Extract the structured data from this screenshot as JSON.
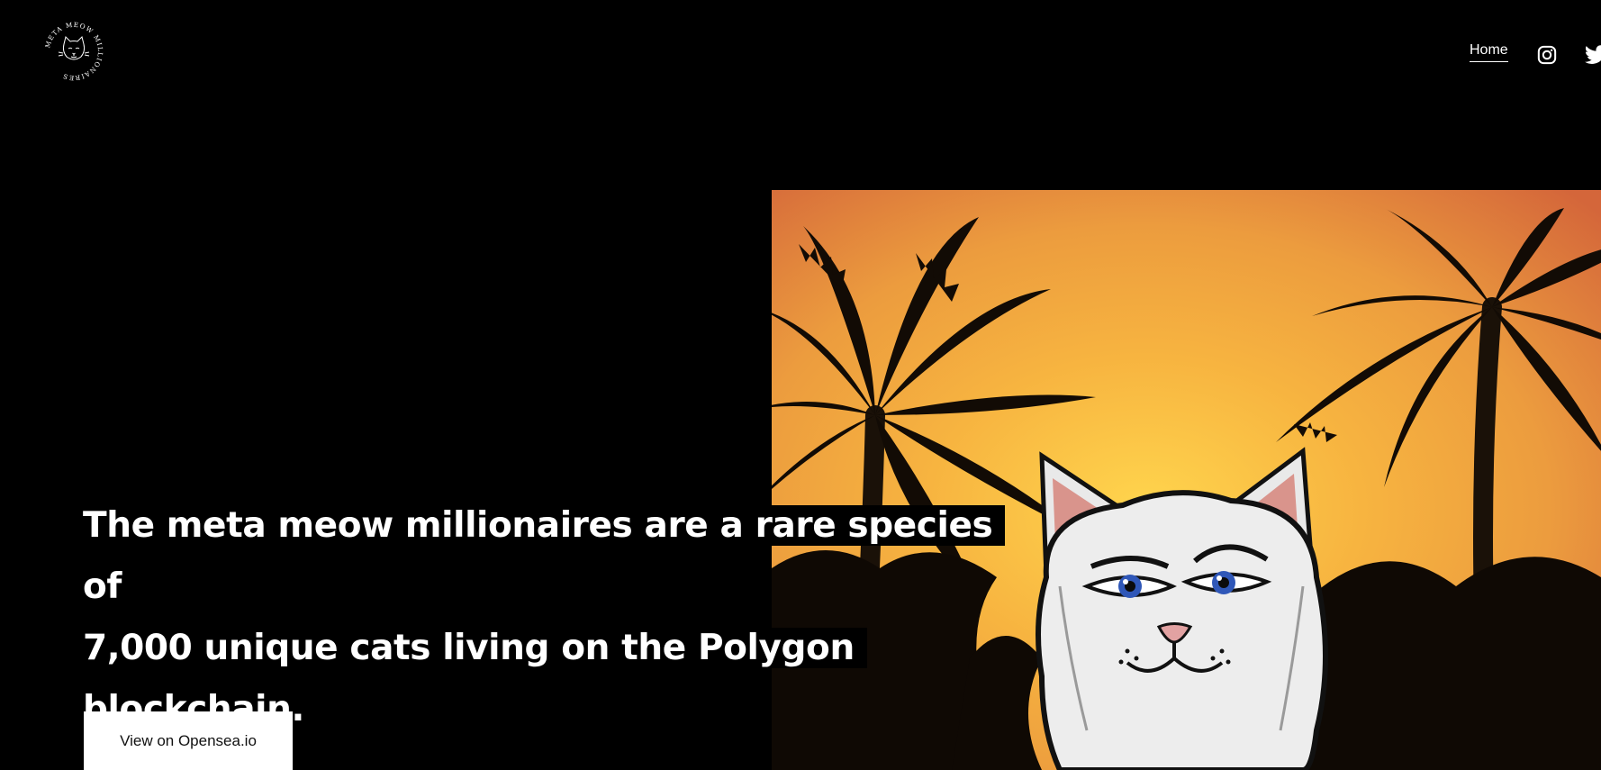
{
  "brand": {
    "logo_ring_text": "META MEOW MILLIONAIRES"
  },
  "nav": {
    "home_label": "Home",
    "instagram_icon": "instagram-icon",
    "twitter_icon": "twitter-icon"
  },
  "hero": {
    "headline_line1": "The meta meow millionaires are a rare species of",
    "headline_line2": "7,000 unique cats living on the Polygon",
    "headline_line3": "blockchain.",
    "cta_label": "View on Opensea.io",
    "image_subject": "white cartoon cat with blue eyes among palm tree silhouettes at sunset"
  },
  "colors": {
    "background": "#000000",
    "text": "#ffffff",
    "button_bg": "#ffffff",
    "button_text": "#111111",
    "sky_top": "#d4663a",
    "sky_mid": "#ec9c3e",
    "sky_glow": "#ffd54d"
  }
}
